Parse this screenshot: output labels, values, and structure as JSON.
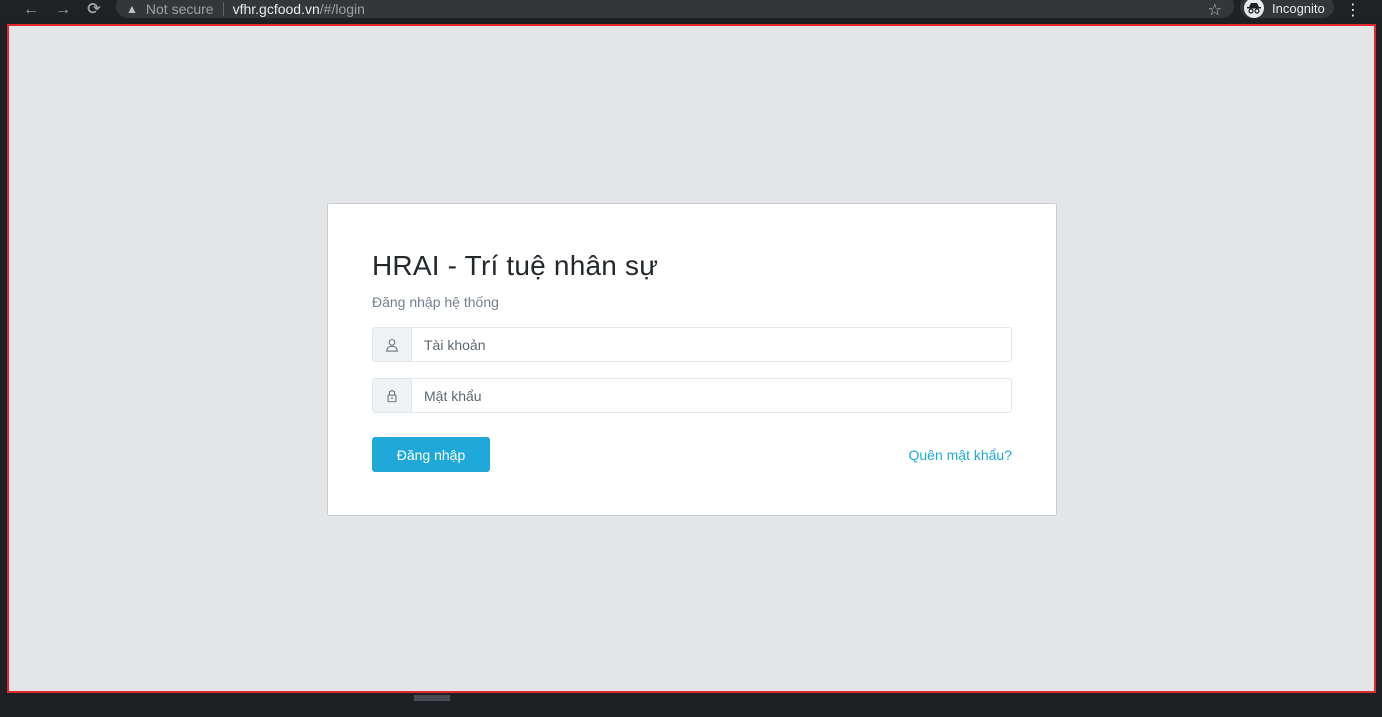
{
  "browser": {
    "back_icon": "←",
    "forward_icon": "→",
    "reload_icon": "⟳",
    "security_icon": "▲",
    "security_label": "Not secure",
    "url_host": "vfhr.gcfood.vn",
    "url_path": "/#/login",
    "bookmark_icon": "☆",
    "incognito_label": "Incognito",
    "menu_icon": "⋮"
  },
  "login": {
    "title": "HRAI - Trí tuệ nhân sự",
    "subtitle": "Đăng nhập hệ thống",
    "username_placeholder": "Tài khoản",
    "password_placeholder": "Mật khẩu",
    "submit_label": "Đăng nhập",
    "forgot_label": "Quên mật khẩu?"
  },
  "colors": {
    "accent": "#20a8d8",
    "background": "#e4e5e6",
    "frame_border": "#e0282e"
  }
}
